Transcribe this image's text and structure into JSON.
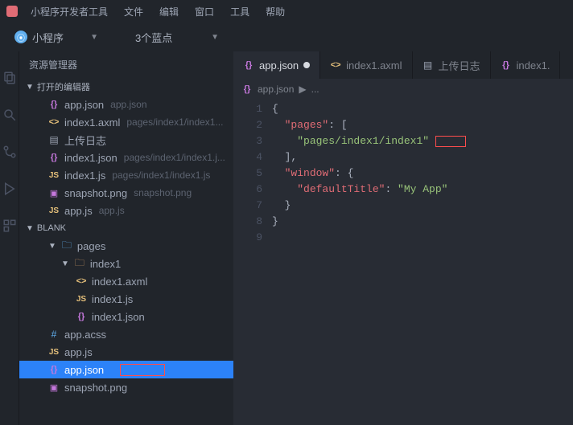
{
  "titlebar": {
    "app_name": "小程序开发者工具",
    "menus": [
      "文件",
      "编辑",
      "窗口",
      "工具",
      "帮助"
    ]
  },
  "toolbar": {
    "platform_label": "小程序",
    "second_label": "3个蓝点"
  },
  "sidebar": {
    "title": "资源管理器",
    "open_editors_label": "打开的编辑器",
    "open_editors": [
      {
        "icon": "json",
        "name": "app.json",
        "path": "app.json"
      },
      {
        "icon": "axml",
        "name": "index1.axml",
        "path": "pages/index1/index1..."
      },
      {
        "icon": "log",
        "name": "上传日志",
        "path": ""
      },
      {
        "icon": "json",
        "name": "index1.json",
        "path": "pages/index1/index1.j..."
      },
      {
        "icon": "js",
        "name": "index1.js",
        "path": "pages/index1/index1.js"
      },
      {
        "icon": "img",
        "name": "snapshot.png",
        "path": "snapshot.png"
      },
      {
        "icon": "js",
        "name": "app.js",
        "path": "app.js"
      }
    ],
    "project_name": "BLANK",
    "tree": {
      "pages": {
        "label": "pages",
        "index1": {
          "label": "index1",
          "files": [
            {
              "icon": "axml",
              "name": "index1.axml"
            },
            {
              "icon": "js",
              "name": "index1.js"
            },
            {
              "icon": "json",
              "name": "index1.json"
            }
          ]
        }
      },
      "root_files": [
        {
          "icon": "acss",
          "name": "app.acss"
        },
        {
          "icon": "js",
          "name": "app.js"
        },
        {
          "icon": "json",
          "name": "app.json",
          "selected": true,
          "highlight": true
        },
        {
          "icon": "img",
          "name": "snapshot.png"
        }
      ]
    }
  },
  "editor": {
    "tabs": [
      {
        "icon": "json",
        "name": "app.json",
        "active": true,
        "modified": true
      },
      {
        "icon": "axml",
        "name": "index1.axml",
        "active": false
      },
      {
        "icon": "log",
        "name": "上传日志",
        "active": false
      },
      {
        "icon": "json",
        "name": "index1.",
        "active": false
      }
    ],
    "breadcrumb": {
      "icon": "json",
      "label": "app.json",
      "sep": "▶",
      "more": "..."
    },
    "code": {
      "lines": [
        "1",
        "2",
        "3",
        "4",
        "5",
        "6",
        "7",
        "8",
        "9"
      ],
      "tokens": [
        [
          {
            "t": "brace",
            "v": "{"
          }
        ],
        [
          {
            "t": "sp",
            "v": "  "
          },
          {
            "t": "key",
            "v": "\"pages\""
          },
          {
            "t": "brace",
            "v": ": ["
          }
        ],
        [
          {
            "t": "sp",
            "v": "    "
          },
          {
            "t": "str",
            "v": "\"pages/index1/index1\""
          },
          {
            "t": "redbox",
            "v": ""
          }
        ],
        [
          {
            "t": "sp",
            "v": "  "
          },
          {
            "t": "brace",
            "v": "],"
          }
        ],
        [
          {
            "t": "sp",
            "v": "  "
          },
          {
            "t": "key",
            "v": "\"window\""
          },
          {
            "t": "brace",
            "v": ": {"
          }
        ],
        [
          {
            "t": "sp",
            "v": "    "
          },
          {
            "t": "key",
            "v": "\"defaultTitle\""
          },
          {
            "t": "brace",
            "v": ": "
          },
          {
            "t": "str",
            "v": "\"My App\""
          }
        ],
        [
          {
            "t": "sp",
            "v": "  "
          },
          {
            "t": "brace",
            "v": "}"
          }
        ],
        [
          {
            "t": "brace",
            "v": "}"
          }
        ],
        []
      ]
    }
  }
}
